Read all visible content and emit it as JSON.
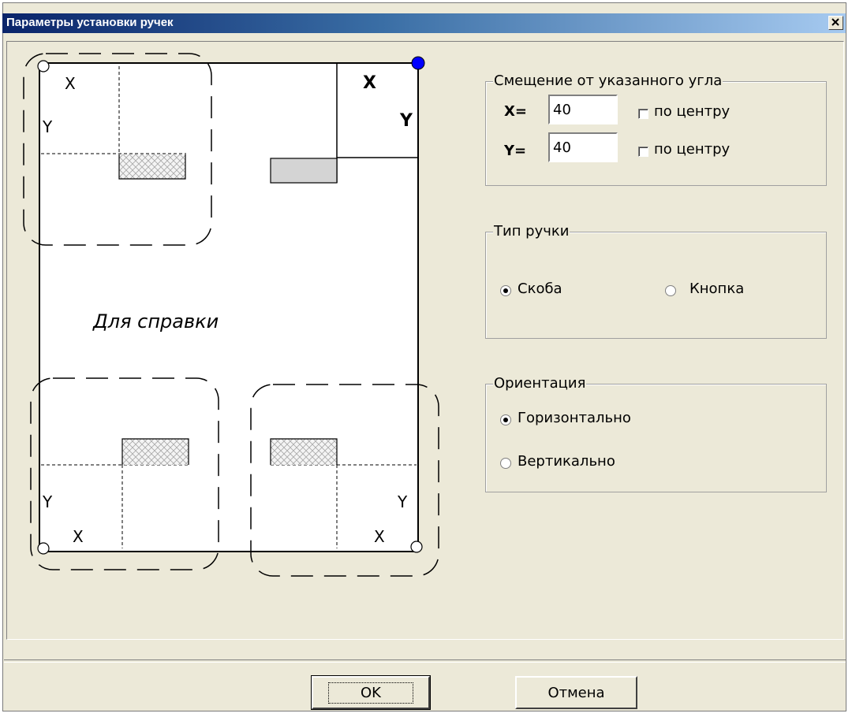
{
  "window": {
    "title": "Параметры установки ручек",
    "close_glyph": "×"
  },
  "diagram": {
    "axis_x": "X",
    "axis_y": "Y",
    "caption": "Для справки"
  },
  "offset": {
    "legend": "Смещение от указанного угла",
    "x_label": "X=",
    "x_value": "40",
    "x_center_label": "по центру",
    "x_center_checked": false,
    "y_label": "Y=",
    "y_value": "40",
    "y_center_label": "по центру",
    "y_center_checked": false
  },
  "handle_type": {
    "legend": "Тип ручки",
    "options": [
      {
        "label": "Скоба",
        "selected": true
      },
      {
        "label": "Кнопка",
        "selected": false
      }
    ]
  },
  "orientation": {
    "legend": "Ориентация",
    "options": [
      {
        "label": "Горизонтально",
        "selected": true
      },
      {
        "label": "Вертикально",
        "selected": false
      }
    ]
  },
  "buttons": {
    "ok": "OK",
    "cancel": "Отмена"
  },
  "colors": {
    "selected_corner": "#0000ff",
    "title_start": "#0a246a",
    "title_end": "#a6caf0"
  }
}
